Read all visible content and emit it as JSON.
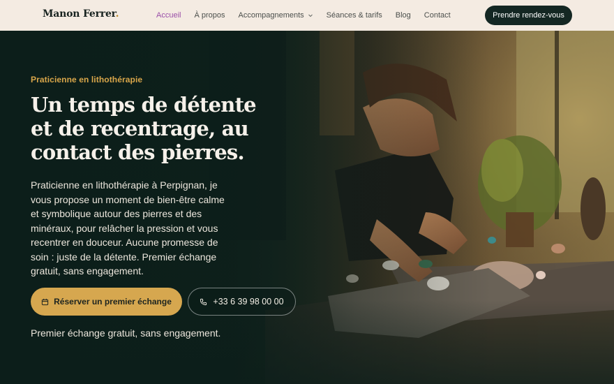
{
  "brand": {
    "name": "Manon Ferrer",
    "dot": "."
  },
  "nav": {
    "items": [
      {
        "label": "Accueil",
        "active": true
      },
      {
        "label": "À propos"
      },
      {
        "label": "Accompagnements",
        "has_dropdown": true
      },
      {
        "label": "Séances & tarifs"
      },
      {
        "label": "Blog"
      },
      {
        "label": "Contact"
      }
    ],
    "cta_label": "Prendre rendez-vous"
  },
  "hero": {
    "eyebrow": "Praticienne en lithothérapie",
    "headline": "Un temps de détente et de recentrage, au contact des pierres.",
    "lead": "Praticienne en lithothérapie à Perpignan, je vous propose un moment de bien-être calme et symbolique autour des pierres et des minéraux, pour relâcher la pression et vous recentrer en douceur. Aucune promesse de soin : juste de la détente. Premier échange gratuit, sans engagement.",
    "primary_button": {
      "label": "Réserver un premier échange",
      "icon": "calendar-icon"
    },
    "secondary_button": {
      "label": "+33 6 39 98 00 00",
      "icon": "phone-icon"
    },
    "note": "Premier échange gratuit, sans engagement."
  },
  "colors": {
    "header_bg": "#f4ebe2",
    "hero_bg": "#0f1f1b",
    "accent_gold": "#d6a74f",
    "nav_active": "#9a4fa8",
    "cta_dark": "#142723"
  }
}
